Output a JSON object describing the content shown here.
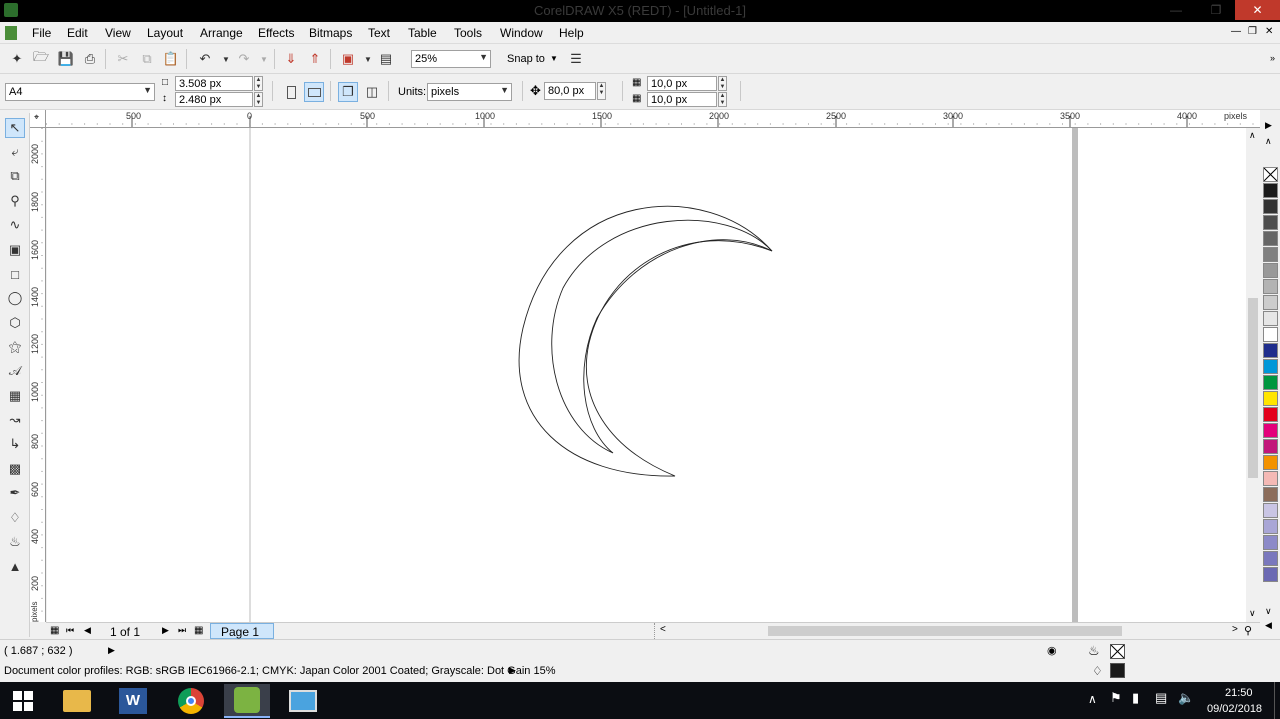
{
  "window": {
    "title": "CorelDRAW X5 (REDT) - [Untitled-1]"
  },
  "menu": [
    "File",
    "Edit",
    "View",
    "Layout",
    "Arrange",
    "Effects",
    "Bitmaps",
    "Text",
    "Table",
    "Tools",
    "Window",
    "Help"
  ],
  "standard_toolbar": {
    "zoom": "25%",
    "snap_to": "Snap to"
  },
  "property_bar": {
    "page_size": "A4",
    "width": "3.508 px",
    "height": "2.480 px",
    "units_label": "Units:",
    "units_value": "pixels",
    "nudge": "80,0 px",
    "dup_x": "10,0 px",
    "dup_y": "10,0 px"
  },
  "ruler": {
    "h_labels": [
      "500",
      "0",
      "500",
      "1000",
      "1500",
      "2000",
      "2500",
      "3000",
      "3500",
      "4000"
    ],
    "h_unit": "pixels",
    "v_labels": [
      "2000",
      "1800",
      "1600",
      "1400",
      "1200",
      "1000",
      "800",
      "600",
      "400",
      "200"
    ],
    "v_unit": "pixels"
  },
  "page_nav": {
    "count": "1 of 1",
    "tab": "Page 1"
  },
  "status": {
    "coords": "( 1.687 ; 632  )",
    "color_profiles": "Document color profiles: RGB: sRGB IEC61966-2.1; CMYK: Japan Color 2001 Coated; Grayscale: Dot Gain 15%"
  },
  "palette_colors": [
    "#ffffff",
    "#1a1a1a",
    "#333333",
    "#4d4d4d",
    "#666666",
    "#808080",
    "#999999",
    "#b3b3b3",
    "#cccccc",
    "#e6e6e6",
    "#ffffff",
    "#1f2d8c",
    "#0097d8",
    "#00963f",
    "#ffe500",
    "#e3001b",
    "#e3007a",
    "#c2167a",
    "#f39200",
    "#f4b9b5",
    "#8c6d5b",
    "#c9c5e4",
    "#a9a6d6",
    "#8c8ac8",
    "#7a78bd",
    "#6b69b3"
  ],
  "taskbar": {
    "time": "21:50",
    "date": "09/02/2018"
  },
  "colors": {
    "accent": "#cfe6fb",
    "close": "#c0392b"
  }
}
